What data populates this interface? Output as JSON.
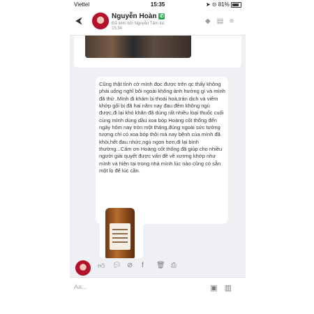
{
  "status": {
    "carrier": "Viettel",
    "time": "15:35",
    "battery": "81%"
  },
  "header": {
    "name": "Nguyễn Hoàn",
    "seen": "Đã xem bởi Nguyễn Tâm lúc 15:34"
  },
  "message": {
    "text": "Cũng thật tình cờ mình đọc được trên qc thấy không phải uống nghĩ bôi ngoài không ảnh hưởng gì và mình đã thử .Mình đi khám bị thoái hoá,tràn dịch và viêm khớp gối bị đã hai năm nay đau đêm không ngủ được,đi lại khó khăn đã dùng rất nhiều loại thuốc cuối cùng mình dùng dầu xoa bóp Hoàng cốt thống đến ngày hôm nay tròn một tháng,đúng ngoài sức tưởng tượng chỉ có xoa bóp thôi mà nay bệnh của mình đã khỏi,hết đau nhức,ngủ ngon hơn,đi lại bình thường...Cảm ơn Hoàng cốt thống đã giúp cho nhiều người giải quyết được vấn đề về xương khớp như mình và hiện tại trong nhà mình lúc nào cũng có sẵn một lọ để lúc cần."
  },
  "input": {
    "placeholder": "Aa..."
  },
  "icons": {
    "back": "back-arrow-icon",
    "header": [
      "tag-icon",
      "note-icon",
      "menu-icon"
    ],
    "actions": [
      "like-icon",
      "comment-icon",
      "hide-icon",
      "facebook-icon",
      "trash-icon",
      "print-icon"
    ],
    "input": [
      "image-icon",
      "chat-icon"
    ]
  }
}
